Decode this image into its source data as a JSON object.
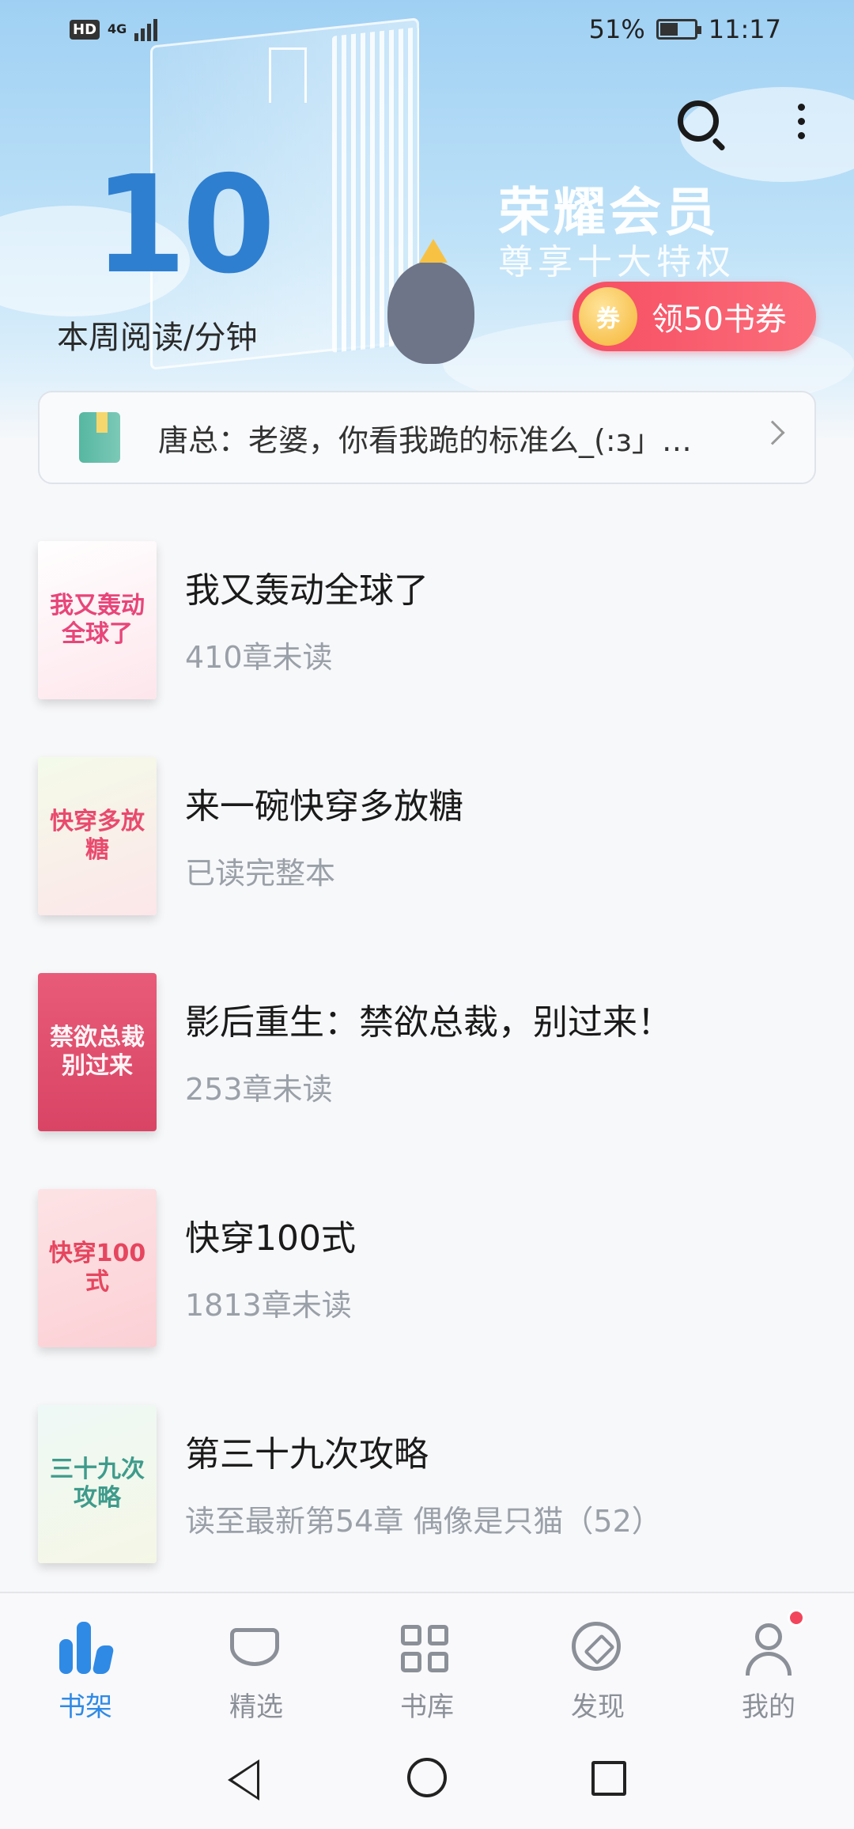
{
  "status_bar": {
    "hd": "HD",
    "network": "4G",
    "battery": "51%",
    "battery_level": 0.51,
    "time": "11:17"
  },
  "header": {
    "reading_minutes": "10",
    "reading_label": "本周阅读/分钟",
    "vip_title": "荣耀会员",
    "vip_subtitle": "尊享十大特权",
    "coupon_icon_text": "券",
    "coupon_label": "领50书券",
    "icons": [
      "search-icon",
      "more-icon"
    ]
  },
  "notice": {
    "text": "唐总：老婆，你看我跪的标准么_(:з」…"
  },
  "books": [
    {
      "title": "我又轰动全球了",
      "progress": "410章未读",
      "cover_text": "我又轰动全球了"
    },
    {
      "title": "来一碗快穿多放糖",
      "progress": "已读完整本",
      "cover_text": "快穿多放糖"
    },
    {
      "title": "影后重生：禁欲总裁，别过来！",
      "progress": "253章未读",
      "cover_text": "禁欲总裁别过来"
    },
    {
      "title": "快穿100式",
      "progress": "1813章未读",
      "cover_text": "快穿100式"
    },
    {
      "title": "第三十九次攻略",
      "progress": "读至最新第54章 偶像是只猫（52）",
      "cover_text": "三十九次攻略"
    }
  ],
  "bottom_nav": [
    {
      "label": "书架",
      "icon": "bookshelf-icon",
      "active": true
    },
    {
      "label": "精选",
      "icon": "diamond-icon",
      "active": false
    },
    {
      "label": "书库",
      "icon": "grid-icon",
      "active": false
    },
    {
      "label": "发现",
      "icon": "compass-icon",
      "active": false
    },
    {
      "label": "我的",
      "icon": "user-icon",
      "active": false,
      "badge": true
    }
  ],
  "colors": {
    "accent": "#2f8ae6",
    "coupon": "#f64d62",
    "inactive": "#8b9098"
  }
}
